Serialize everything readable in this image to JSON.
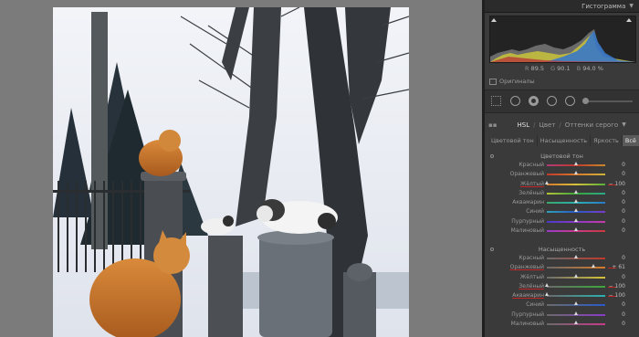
{
  "panel": {
    "histogram_title": "Гистограмма",
    "rgb": {
      "r_label": "R",
      "r": "89.5",
      "g_label": "G",
      "g": "90.1",
      "b_label": "B",
      "b": "94.0",
      "unit": "%"
    },
    "originals_label": "Оригиналы",
    "hsl_header": {
      "hsl": "HSL",
      "color": "Цвет",
      "slash": "/",
      "grayscale": "Оттенки серого"
    },
    "tabs": [
      "Цветовой тон",
      "Насыщенность",
      "Яркость",
      "Всё"
    ],
    "active_tab": "Всё",
    "hue_section": {
      "title": "Цветовой тон",
      "rows": [
        {
          "label": "Красный",
          "value": "0",
          "pos": 0.5,
          "grad": "linear-gradient(90deg,#b03a7a,#c0392b,#c98a2a)",
          "mark": false
        },
        {
          "label": "Оранжевый",
          "value": "0",
          "pos": 0.5,
          "grad": "linear-gradient(90deg,#c0392b,#d8792a,#cfb43a)",
          "mark": false
        },
        {
          "label": "Жёлтый",
          "value": "− 100",
          "pos": 0.0,
          "grad": "linear-gradient(90deg,#d8792a,#d6c23a,#58b03a)",
          "mark": true
        },
        {
          "label": "Зелёный",
          "value": "0",
          "pos": 0.5,
          "grad": "linear-gradient(90deg,#b8c23a,#3aa83a,#2aa88a)",
          "mark": false
        },
        {
          "label": "Аквамарин",
          "value": "0",
          "pos": 0.5,
          "grad": "linear-gradient(90deg,#3aa86a,#2ab0b0,#2a7ac8)",
          "mark": false
        },
        {
          "label": "Синий",
          "value": "0",
          "pos": 0.5,
          "grad": "linear-gradient(90deg,#2aa0b8,#2a5ac8,#7a3ac8)",
          "mark": false
        },
        {
          "label": "Пурпурный",
          "value": "0",
          "pos": 0.5,
          "grad": "linear-gradient(90deg,#4a3ac8,#8a3ac8,#c83aa8)",
          "mark": false
        },
        {
          "label": "Малиновый",
          "value": "0",
          "pos": 0.5,
          "grad": "linear-gradient(90deg,#9a3ac8,#c83a8a,#c83a3a)",
          "mark": false
        }
      ]
    },
    "sat_section": {
      "title": "Насыщенность",
      "rows": [
        {
          "label": "Красный",
          "value": "0",
          "pos": 0.5,
          "grad": "linear-gradient(90deg,#6a6a6a,#c0392b)",
          "mark": false
        },
        {
          "label": "Оранжевый",
          "value": "+ 61",
          "pos": 0.8,
          "grad": "linear-gradient(90deg,#6a6a6a,#d8792a)",
          "mark": true
        },
        {
          "label": "Жёлтый",
          "value": "0",
          "pos": 0.5,
          "grad": "linear-gradient(90deg,#6a6a6a,#d6c23a)",
          "mark": false
        },
        {
          "label": "Зелёный",
          "value": "− 100",
          "pos": 0.0,
          "grad": "linear-gradient(90deg,#6a6a6a,#3aa83a)",
          "mark": true
        },
        {
          "label": "Аквамарин",
          "value": "− 100",
          "pos": 0.0,
          "grad": "linear-gradient(90deg,#6a6a6a,#2ab0b0)",
          "mark": true
        },
        {
          "label": "Синий",
          "value": "0",
          "pos": 0.5,
          "grad": "linear-gradient(90deg,#6a6a6a,#2a5ac8)",
          "mark": false
        },
        {
          "label": "Пурпурный",
          "value": "0",
          "pos": 0.5,
          "grad": "linear-gradient(90deg,#6a6a6a,#8a3ac8)",
          "mark": false
        },
        {
          "label": "Малиновый",
          "value": "0",
          "pos": 0.5,
          "grad": "linear-gradient(90deg,#6a6a6a,#c83a8a)",
          "mark": false
        }
      ]
    }
  },
  "icons": {
    "collapse": "triangle-down-icon",
    "plus": "plus-icon",
    "grid": "grid-icon",
    "circle": "crop-circle-icon",
    "target": "target-circle-icon",
    "dot": "spot-removal-icon"
  }
}
